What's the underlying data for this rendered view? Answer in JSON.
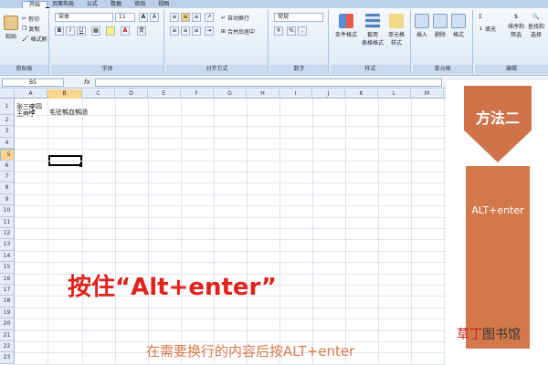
{
  "ribbon": {
    "tabs": [
      "开始",
      "插入",
      "页面布局",
      "公式",
      "数据",
      "审阅",
      "视图"
    ],
    "clipboard": {
      "paste": "粘贴",
      "cut": "剪切",
      "copy": "复制",
      "format_painter": "格式刷",
      "label": "剪贴板"
    },
    "font": {
      "name": "宋体",
      "size": "11",
      "bold": "B",
      "italic": "I",
      "underline": "U",
      "label": "字体",
      "grow": "A",
      "shrink": "A",
      "wen": "变"
    },
    "alignment": {
      "wrap_text": "自动换行",
      "merge_center": "合并后居中",
      "label": "对齐方式"
    },
    "number": {
      "format": "常规",
      "percent": "%",
      "comma": ",",
      "label": "数字"
    },
    "styles": {
      "conditional": "条件格式",
      "table": "套用\n表格格式",
      "cell_styles": "单元格\n样式",
      "label": "样式"
    },
    "cells": {
      "insert": "插入",
      "delete": "删除",
      "format": "格式",
      "label": "单元格"
    },
    "editing": {
      "fill": "填充",
      "sort_filter": "排序和\n筛选",
      "find_select": "查找和\n选择",
      "label": "编辑",
      "sigma": "Σ"
    }
  },
  "formula_bar": {
    "name_box": "B5",
    "fx": "fx"
  },
  "columns": [
    "A",
    "B",
    "C",
    "D",
    "E",
    "F",
    "G",
    "H",
    "I",
    "J",
    "K",
    "L",
    "M",
    "N",
    "O",
    "P"
  ],
  "rows": [
    "1",
    "2",
    "3",
    "4",
    "5",
    "6",
    "7",
    "8",
    "9",
    "10",
    "11",
    "12",
    "13",
    "14",
    "15",
    "16",
    "17",
    "18",
    "19",
    "20",
    "21",
    "22",
    "23"
  ],
  "cells": {
    "a1_line1": "张三李四",
    "a1_line2": "王麻子",
    "b1": "毛驻鹌血鹌肠"
  },
  "overlay": {
    "method": "方法二",
    "shortcut": "ALT+enter",
    "headline": "按住“Alt+enter”",
    "instruction": "在需要换行的内容后按ALT+enter",
    "watermark_red": "草丁",
    "watermark_black": "图书馆"
  },
  "colors": {
    "accent": "#d3784a",
    "headline": "#e0231b",
    "ribbon": "#dce8f6"
  }
}
